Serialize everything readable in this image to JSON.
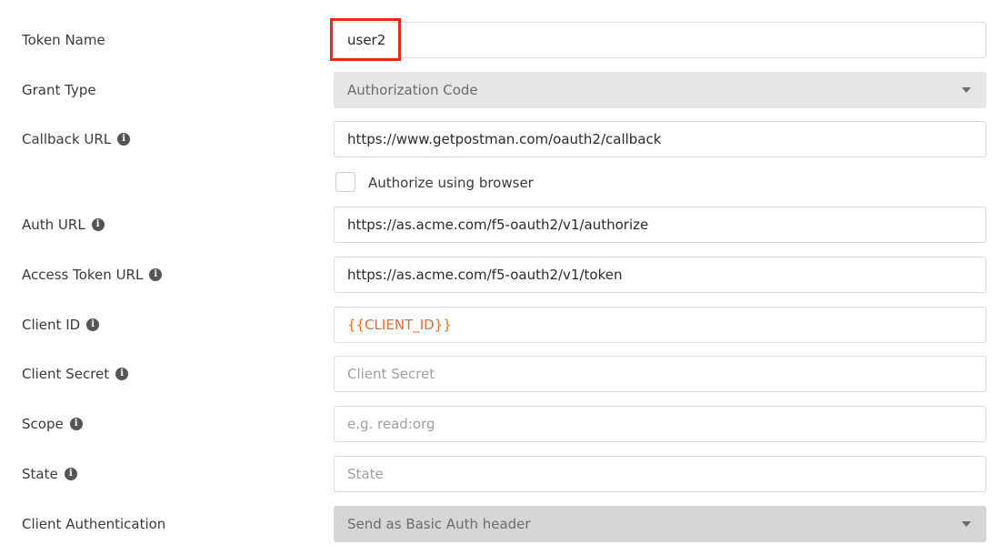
{
  "form": {
    "token_name": {
      "label": "Token Name",
      "value": "user2"
    },
    "grant_type": {
      "label": "Grant Type",
      "value": "Authorization Code"
    },
    "callback_url": {
      "label": "Callback URL",
      "value": "https://www.getpostman.com/oauth2/callback"
    },
    "authorize_browser": {
      "label": "Authorize using browser",
      "checked": false
    },
    "auth_url": {
      "label": "Auth URL",
      "value": "https://as.acme.com/f5-oauth2/v1/authorize"
    },
    "access_token_url": {
      "label": "Access Token URL",
      "value": "https://as.acme.com/f5-oauth2/v1/token"
    },
    "client_id": {
      "label": "Client ID",
      "value": "{{CLIENT_ID}}"
    },
    "client_secret": {
      "label": "Client Secret",
      "placeholder": "Client Secret"
    },
    "scope": {
      "label": "Scope",
      "placeholder": "e.g. read:org"
    },
    "state": {
      "label": "State",
      "placeholder": "State"
    },
    "client_auth": {
      "label": "Client Authentication",
      "value": "Send as Basic Auth header"
    }
  },
  "icons": {
    "info": "info-icon",
    "dropdown": "chevron-down-icon"
  },
  "colors": {
    "highlight": "#e02b1d",
    "variable_text": "#e86a2c",
    "select_bg": "#e6e6e6"
  }
}
